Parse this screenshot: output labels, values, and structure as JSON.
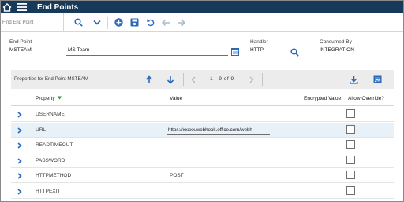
{
  "app": {
    "title": "End Points"
  },
  "toolbar": {
    "find_placeholder": "Find End Point",
    "icons": [
      "search-icon",
      "chevron-down-icon",
      "add-icon",
      "save-icon",
      "undo-icon",
      "arrow-left-icon",
      "arrow-right-icon"
    ]
  },
  "header": {
    "endpoint_label": "End Point",
    "endpoint_value": "MSTEAM",
    "description_value": "MS Team",
    "handler_label": "Handler",
    "handler_value": "HTTP",
    "consumed_label": "Consumed By",
    "consumed_value": "INTEGRATION"
  },
  "table": {
    "title": "Properties for End Point MSTEAM",
    "pager": "1 - 9 of 9",
    "columns": {
      "property": "Property",
      "value": "Value",
      "encrypted": "Encrypted Value",
      "override": "Allow Override?"
    },
    "rows": [
      {
        "property": "USERNAME",
        "value": "",
        "selected": false
      },
      {
        "property": "URL",
        "value": "https://xxxxx.webhook.office.com/webh",
        "selected": true
      },
      {
        "property": "READTIMEOUT",
        "value": "",
        "selected": false
      },
      {
        "property": "PASSWORD",
        "value": "",
        "selected": false
      },
      {
        "property": "HTTPMETHOD",
        "value": "POST",
        "selected": false
      },
      {
        "property": "HTTPEXIT",
        "value": "",
        "selected": false
      }
    ]
  },
  "colors": {
    "titlebar": "#183a5a",
    "accent": "#0f62fe",
    "link_blue": "#2a6ab8",
    "sort_green": "#24a148",
    "selected_row": "#e8f0f8"
  }
}
